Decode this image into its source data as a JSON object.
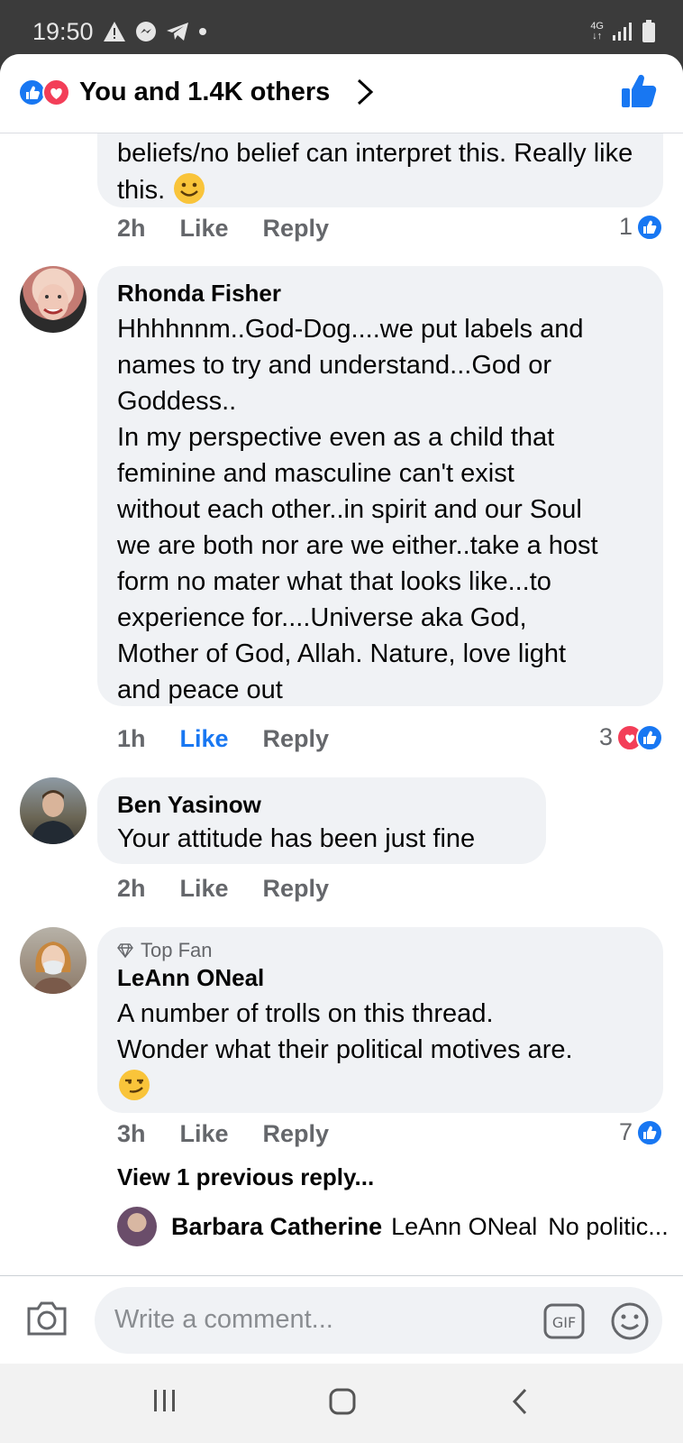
{
  "status_bar": {
    "time": "19:50",
    "network": "4G",
    "icons": [
      "warning-icon",
      "messenger-icon",
      "telegram-icon",
      "dot-icon",
      "signal-icon",
      "battery-icon"
    ]
  },
  "header": {
    "title": "You and 1.4K others",
    "reactions": [
      "like-reaction-icon",
      "love-reaction-icon"
    ]
  },
  "comments": [
    {
      "partial_text": "beliefs/no belief can interpret this. Really like this.",
      "time": "2h",
      "like_label": "Like",
      "reply_label": "Reply",
      "reaction_count": "1"
    },
    {
      "author": "Rhonda Fisher",
      "text_lines": [
        "Hhhhnnm..God-Dog....we put labels and",
        "names to try and understand...God or",
        "Goddess..",
        "In my perspective even as a child that",
        "feminine and masculine can't exist",
        "without each other..in spirit and our Soul",
        "we are both nor are we either..take a host",
        "form no mater what that looks like...to",
        "experience for....Universe aka God,",
        "Mother of God, Allah. Nature, love light",
        "and peace out"
      ],
      "time": "1h",
      "like_label": "Like",
      "reply_label": "Reply",
      "reaction_count": "3",
      "liked": true
    },
    {
      "author": "Ben Yasinow",
      "text": "Your attitude has been just fine",
      "time": "2h",
      "like_label": "Like",
      "reply_label": "Reply"
    },
    {
      "badge": "Top Fan",
      "author": "LeAnn ONeal",
      "text_lines": [
        "A number of trolls on this thread.",
        "Wonder what their political motives are."
      ],
      "time": "3h",
      "like_label": "Like",
      "reply_label": "Reply",
      "reaction_count": "7"
    }
  ],
  "view_previous": "View 1 previous reply...",
  "reply_preview": {
    "author": "Barbara Catherine",
    "mention": "LeAnn ONeal",
    "text": "No politic..."
  },
  "composer": {
    "placeholder": "Write a comment..."
  },
  "colors": {
    "accent": "#1877f2",
    "love": "#f33e58",
    "bubble": "#f0f2f5",
    "secondary_text": "#65676b"
  }
}
